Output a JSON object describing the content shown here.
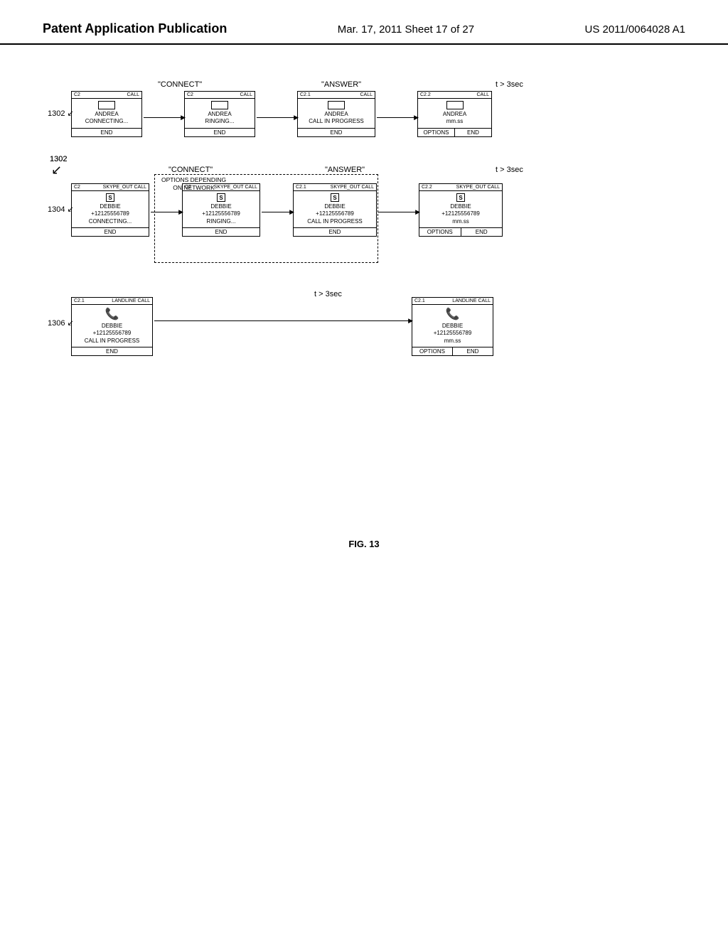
{
  "header": {
    "left": "Patent Application Publication",
    "center": "Mar. 17, 2011  Sheet 17 of 27",
    "right": "US 2011/0064028 A1"
  },
  "figure": {
    "caption": "FIG. 13"
  },
  "diagram": {
    "labels": {
      "connect": "\"CONNECT\"",
      "answer": "\"ANSWER\"",
      "t3sec_top": "t > 3sec",
      "t3sec_row2": "t > 3sec",
      "t3sec_row3": "t > 3sec",
      "options_depending": "OPTIONS DEPENDING\nON NETWORK"
    },
    "row_labels": {
      "r1302": "1302",
      "r1304": "1304",
      "r1306": "1306"
    },
    "row1": {
      "box1": {
        "corner": "C2",
        "title": "CALL",
        "has_rect": true,
        "lines": [
          "ANDREA",
          "CONNECTING..."
        ],
        "buttons": [
          "END"
        ]
      },
      "box2": {
        "corner": "C2",
        "title": "CALL",
        "has_rect": true,
        "lines": [
          "ANDREA",
          "RINGING..."
        ],
        "buttons": [
          "END"
        ]
      },
      "box3": {
        "corner": "C2.1",
        "title": "CALL",
        "has_rect": true,
        "lines": [
          "ANDREA",
          "CALL IN PROGRESS"
        ],
        "buttons": [
          "END"
        ]
      },
      "box4": {
        "corner": "C2.2",
        "title": "CALL",
        "has_rect": true,
        "lines": [
          "ANDREA",
          "mm.ss"
        ],
        "buttons": [
          "OPTIONS",
          "END"
        ]
      }
    },
    "row2": {
      "box1": {
        "corner": "C2",
        "title": "SKYPE_OUT CALL",
        "has_s": true,
        "lines": [
          "DEBBIE",
          "+12125556789",
          "CONNECTING..."
        ],
        "buttons": [
          "END"
        ]
      },
      "box2": {
        "corner": "C2",
        "title": "SKYPE_OUT CALL",
        "has_s": true,
        "lines": [
          "DEBBIE",
          "+12125556789",
          "RINGING..."
        ],
        "buttons": [
          "END"
        ]
      },
      "box3": {
        "corner": "C2.1",
        "title": "SKYPE_OUT CALL",
        "has_s": true,
        "lines": [
          "DEBBIE",
          "+12125556789",
          "CALL IN PROGRESS"
        ],
        "buttons": [
          "END"
        ]
      },
      "box4": {
        "corner": "C2.2",
        "title": "SKYPE_OUT CALL",
        "has_s": true,
        "lines": [
          "DEBBIE",
          "+12125556789",
          "mm.ss"
        ],
        "buttons": [
          "OPTIONS",
          "END"
        ]
      }
    },
    "row3": {
      "box1": {
        "corner": "C2.1",
        "title": "LANDLINE CALL",
        "has_phone": true,
        "lines": [
          "DEBBIE",
          "+12125556789",
          "CALL IN PROGRESS"
        ],
        "buttons": [
          "END"
        ]
      },
      "box2": {
        "corner": "C2.1",
        "title": "LANDLINE CALL",
        "has_phone": true,
        "lines": [
          "DEBBIE",
          "+12125556789",
          "mm.ss"
        ],
        "buttons": [
          "OPTIONS",
          "END"
        ]
      }
    }
  }
}
